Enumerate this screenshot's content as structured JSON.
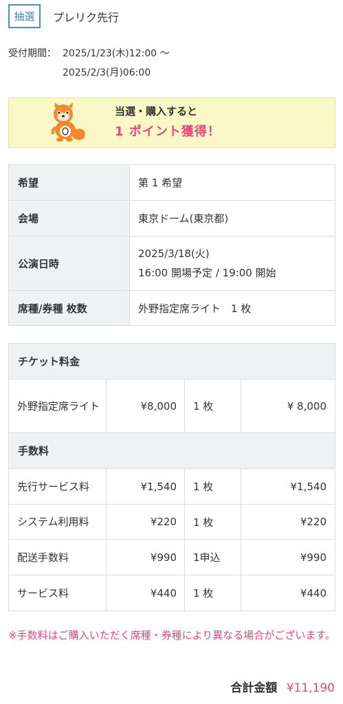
{
  "header": {
    "badge": "抽選",
    "sale_type": "プレリク先行"
  },
  "period": {
    "label": "受付期間：",
    "start": "2025/1/23(木)12:00 〜",
    "end": "2025/2/3(月)06:00"
  },
  "points_banner": {
    "line1": "当選・購入すると",
    "line2": "1 ポイント獲得！",
    "mascot_caption": "Ponta"
  },
  "info": [
    {
      "label": "希望",
      "value": "第 1 希望"
    },
    {
      "label": "会場",
      "value": "東京ドーム(東京都)"
    },
    {
      "label": "公演日時",
      "value": "2025/3/18(火)",
      "value2": "16:00 開場予定 / 19:00 開始"
    },
    {
      "label": "席種/券種 枚数",
      "value": "外野指定席ライト　1 枚"
    }
  ],
  "ticket_section": {
    "title": "チケット料金",
    "rows": [
      {
        "name": "外野指定席ライト",
        "price": "¥8,000",
        "qty": "1 枚",
        "total": "¥ 8,000"
      }
    ]
  },
  "fee_section": {
    "title": "手数料",
    "rows": [
      {
        "name": "先行サービス料",
        "price": "¥1,540",
        "qty": "1 枚",
        "total": "¥1,540"
      },
      {
        "name": "システム利用料",
        "price": "¥220",
        "qty": "1 枚",
        "total": "¥220"
      },
      {
        "name": "配送手数料",
        "price": "¥990",
        "qty": "1申込",
        "total": "¥990"
      },
      {
        "name": "サービス料",
        "price": "¥440",
        "qty": "1 枚",
        "total": "¥440"
      }
    ]
  },
  "note": "※手数料はご購入いただく席種・券種により異なる場合がございます。",
  "grand_total": {
    "label": "合計金額",
    "value": "¥11,190"
  },
  "colors": {
    "accent_blue": "#4a90c4",
    "pink": "#e8467c",
    "banner_bg": "#fbf8c8",
    "label_bg": "#eef2f3"
  }
}
